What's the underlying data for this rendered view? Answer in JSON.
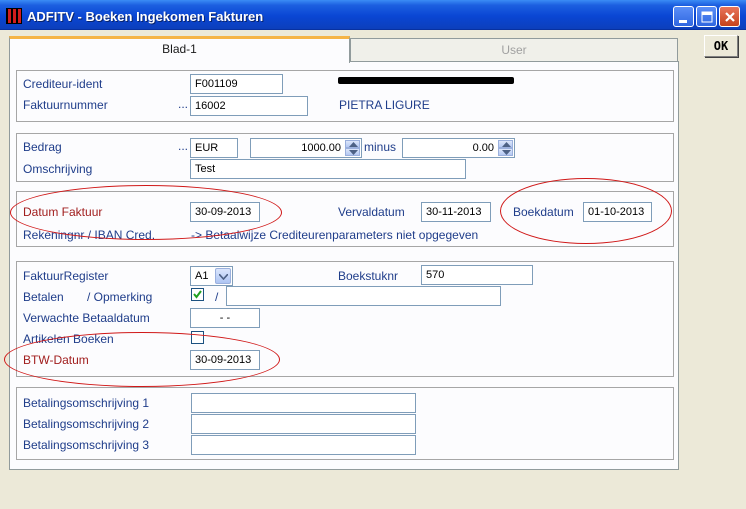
{
  "window": {
    "title": "ADFITV - Boeken Ingekomen Fakturen"
  },
  "ok_button": {
    "label": "OK"
  },
  "tabs": [
    {
      "label": "Blad-1",
      "active": true
    },
    {
      "label": "User",
      "active": false
    }
  ],
  "section_creditor": {
    "crediteur_label": "Crediteur-ident",
    "crediteur_value": "F001109",
    "faktuurnummer_label": "Faktuurnummer",
    "faktuurnummer_ellipsis": "...",
    "faktuurnummer_value": "16002",
    "city": "PIETRA LIGURE"
  },
  "section_amount": {
    "bedrag_label": "Bedrag",
    "bedrag_ellipsis": "...",
    "currency": "EUR",
    "amount": "1000.00",
    "minus_label": "minus",
    "minus_amount": "0.00",
    "omschrijving_label": "Omschrijving",
    "omschrijving_value": "Test"
  },
  "section_dates": {
    "datum_faktuur_label": "Datum Faktuur",
    "datum_faktuur_value": "30-09-2013",
    "vervaldatum_label": "Vervaldatum",
    "vervaldatum_value": "30-11-2013",
    "boekdatum_label": "Boekdatum",
    "boekdatum_value": "01-10-2013",
    "rekening_label": "Rekeningnr / IBAN Cred.",
    "rekening_value": "-> Betaalwijze Crediteurenparameters niet opgegeven"
  },
  "section_register": {
    "faktuurregister_label": "FaktuurRegister",
    "faktuurregister_value": "A1",
    "boekstuknr_label": "Boekstuknr",
    "boekstuknr_value": "570",
    "betalen_label": "Betalen",
    "opmerking_label": "/ Opmerking",
    "betalen_checked": true,
    "slash": "/",
    "opmerking_value": "",
    "verwachte_label": "Verwachte Betaaldatum",
    "verwachte_value": "- -",
    "artikelen_label": "Artikelen Boeken",
    "artikelen_checked": false,
    "btw_label": "BTW-Datum",
    "btw_value": "30-09-2013"
  },
  "section_payment": {
    "omschrijving1_label": "Betalingsomschrijving 1",
    "omschrijving1_value": "",
    "omschrijving2_label": "Betalingsomschrijving 2",
    "omschrijving2_value": "",
    "omschrijving3_label": "Betalingsomschrijving 3",
    "omschrijving3_value": ""
  },
  "colors": {
    "label_blue": "#1f3d8a",
    "label_red": "#a11e1e",
    "annotation_red": "#d01818",
    "titlebar_blue": "#0a46d4"
  }
}
